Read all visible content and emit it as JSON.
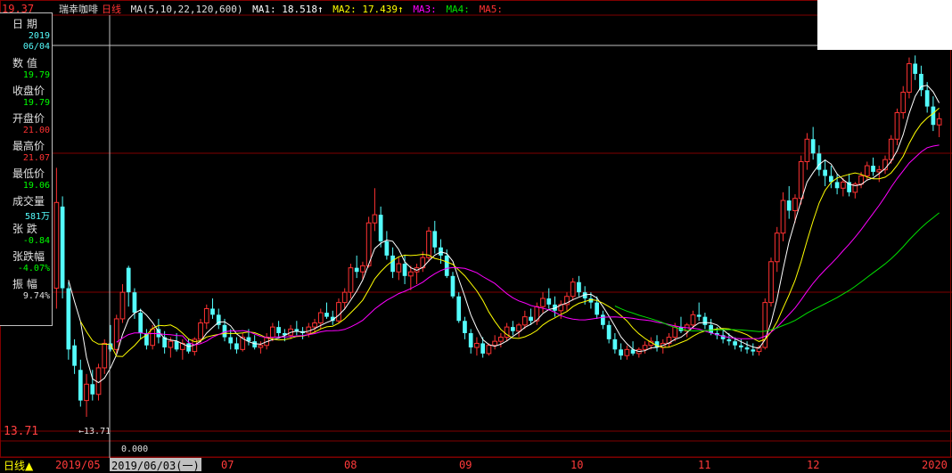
{
  "header": {
    "stock_name": "瑞幸咖啡",
    "period_label": "日线",
    "ma_label": "MA(5,10,22,120,600)",
    "ma1": "MA1: 18.518↑",
    "ma2": "MA2: 17.439↑",
    "ma3": "MA3:",
    "ma4": "MA4:",
    "ma5": "MA5:",
    "top_left_price": "19.37"
  },
  "colors": {
    "up": "#ff3232",
    "down": "#54fcfc",
    "ma1": "#ffffff",
    "ma2": "#ffff00",
    "ma3": "#ff00ff",
    "ma4": "#00e000",
    "grid": "#800000",
    "crosshair": "#c0c0c0"
  },
  "info_panel": {
    "items": [
      {
        "label": "日 期",
        "value": "2019",
        "value2": "06/04",
        "color": "#54fcfc"
      },
      {
        "label": "数 值",
        "value": "19.79",
        "color": "#00ff00"
      },
      {
        "label": "收盘价",
        "value": "19.79",
        "color": "#00ff00"
      },
      {
        "label": "开盘价",
        "value": "21.00",
        "color": "#ff3232"
      },
      {
        "label": "最高价",
        "value": "21.07",
        "color": "#ff3232"
      },
      {
        "label": "最低价",
        "value": "19.06",
        "color": "#00ff00"
      },
      {
        "label": "成交量",
        "value": "581万",
        "color": "#54fcfc"
      },
      {
        "label": "张 跌",
        "value": "-0.84",
        "color": "#00ff00"
      },
      {
        "label": "张跌幅",
        "value": "-4.07%",
        "color": "#00ff00"
      },
      {
        "label": "振 幅",
        "value": "9.74%",
        "color": "#e0e0e0"
      }
    ]
  },
  "annotations": {
    "low_marker": "←13.71",
    "left_axis_price": "13.71",
    "zero_value": "0.000"
  },
  "time_axis": {
    "period_button": "日线▲",
    "selected_date": "2019/06/03(一)",
    "labels": [
      "2019/05",
      "07",
      "08",
      "09",
      "10",
      "11",
      "12",
      "2020"
    ]
  },
  "chart_data": {
    "type": "candlestick",
    "title": "",
    "y_range": [
      13.0,
      31.5
    ],
    "low_price": 13.71,
    "candles_note": "daily OHLC approx, 2019/05 - 2020/01",
    "ohlc": [
      [
        20.0,
        25.9,
        19.0,
        24.2
      ],
      [
        24.0,
        24.5,
        19.5,
        20.0
      ],
      [
        20.0,
        20.3,
        16.5,
        17.0
      ],
      [
        17.2,
        17.5,
        15.8,
        16.2
      ],
      [
        16.0,
        16.5,
        14.2,
        14.5
      ],
      [
        14.5,
        15.8,
        13.7,
        15.3
      ],
      [
        15.3,
        16.0,
        14.5,
        14.8
      ],
      [
        14.8,
        16.3,
        14.5,
        16.1
      ],
      [
        16.1,
        17.5,
        15.8,
        17.3
      ],
      [
        17.3,
        18.2,
        16.9,
        17.0
      ],
      [
        17.0,
        18.7,
        16.8,
        18.5
      ],
      [
        18.5,
        20.2,
        18.3,
        19.8
      ],
      [
        21.0,
        21.1,
        19.1,
        19.8
      ],
      [
        19.8,
        20.0,
        18.5,
        18.8
      ],
      [
        18.8,
        19.0,
        17.5,
        17.8
      ],
      [
        17.8,
        18.0,
        17.0,
        17.2
      ],
      [
        17.2,
        18.2,
        17.0,
        18.0
      ],
      [
        18.0,
        18.5,
        17.3,
        17.6
      ],
      [
        17.6,
        17.9,
        16.8,
        17.1
      ],
      [
        17.1,
        17.6,
        16.6,
        17.4
      ],
      [
        17.4,
        17.8,
        16.9,
        17.0
      ],
      [
        17.0,
        17.5,
        16.5,
        17.3
      ],
      [
        17.3,
        17.5,
        16.8,
        16.9
      ],
      [
        16.9,
        17.6,
        16.7,
        17.5
      ],
      [
        17.5,
        18.5,
        17.3,
        18.3
      ],
      [
        18.3,
        19.2,
        18.0,
        19.0
      ],
      [
        19.0,
        19.5,
        18.5,
        18.7
      ],
      [
        18.7,
        19.0,
        18.0,
        18.2
      ],
      [
        18.2,
        18.5,
        17.4,
        17.6
      ],
      [
        17.6,
        18.0,
        17.0,
        17.3
      ],
      [
        17.3,
        17.6,
        16.8,
        17.0
      ],
      [
        17.0,
        17.8,
        16.9,
        17.6
      ],
      [
        17.6,
        18.0,
        17.2,
        17.4
      ],
      [
        17.4,
        17.7,
        17.0,
        17.1
      ],
      [
        17.1,
        17.4,
        16.8,
        17.2
      ],
      [
        17.2,
        17.8,
        17.0,
        17.6
      ],
      [
        17.6,
        18.3,
        17.4,
        18.1
      ],
      [
        18.1,
        18.4,
        17.6,
        17.8
      ],
      [
        17.8,
        18.0,
        17.4,
        17.7
      ],
      [
        17.7,
        18.2,
        17.5,
        18.0
      ],
      [
        18.0,
        18.4,
        17.7,
        17.9
      ],
      [
        17.9,
        18.1,
        17.5,
        17.8
      ],
      [
        17.8,
        18.3,
        17.6,
        18.1
      ],
      [
        18.1,
        18.5,
        17.8,
        18.3
      ],
      [
        18.3,
        19.0,
        18.0,
        18.8
      ],
      [
        18.8,
        19.3,
        18.5,
        18.6
      ],
      [
        18.6,
        18.9,
        18.2,
        18.4
      ],
      [
        18.4,
        19.5,
        18.3,
        19.3
      ],
      [
        19.3,
        20.0,
        19.0,
        19.8
      ],
      [
        19.8,
        21.2,
        19.5,
        21.0
      ],
      [
        21.0,
        21.6,
        20.5,
        20.8
      ],
      [
        20.8,
        21.3,
        20.4,
        21.1
      ],
      [
        21.1,
        23.5,
        21.0,
        23.2
      ],
      [
        23.2,
        24.9,
        22.8,
        23.6
      ],
      [
        23.6,
        24.0,
        22.0,
        22.3
      ],
      [
        22.3,
        22.8,
        21.4,
        21.6
      ],
      [
        21.6,
        22.0,
        20.5,
        20.8
      ],
      [
        20.8,
        21.5,
        20.4,
        21.2
      ],
      [
        21.2,
        21.6,
        20.2,
        20.6
      ],
      [
        20.6,
        21.1,
        19.9,
        20.8
      ],
      [
        20.8,
        21.2,
        20.2,
        21.0
      ],
      [
        21.0,
        21.8,
        20.8,
        21.5
      ],
      [
        21.5,
        23.0,
        21.3,
        22.8
      ],
      [
        22.8,
        23.3,
        21.7,
        22.0
      ],
      [
        22.0,
        22.4,
        21.2,
        21.6
      ],
      [
        21.6,
        21.9,
        20.5,
        20.6
      ],
      [
        20.6,
        20.8,
        19.5,
        19.6
      ],
      [
        19.6,
        19.8,
        18.3,
        18.4
      ],
      [
        18.4,
        18.6,
        17.5,
        17.8
      ],
      [
        17.8,
        18.0,
        16.8,
        17.1
      ],
      [
        17.1,
        17.6,
        16.7,
        17.3
      ],
      [
        17.3,
        17.6,
        16.6,
        16.8
      ],
      [
        16.8,
        17.3,
        16.7,
        17.2
      ],
      [
        17.2,
        17.7,
        17.0,
        17.4
      ],
      [
        17.4,
        17.8,
        17.1,
        17.6
      ],
      [
        17.6,
        18.3,
        17.4,
        18.1
      ],
      [
        18.1,
        18.4,
        17.7,
        17.9
      ],
      [
        17.9,
        18.3,
        17.6,
        18.2
      ],
      [
        18.2,
        18.9,
        18.0,
        18.6
      ],
      [
        18.6,
        19.0,
        18.2,
        18.4
      ],
      [
        18.4,
        19.3,
        18.2,
        19.1
      ],
      [
        19.1,
        19.8,
        18.8,
        19.5
      ],
      [
        19.5,
        20.0,
        19.0,
        19.2
      ],
      [
        19.2,
        19.6,
        18.6,
        18.9
      ],
      [
        18.9,
        19.4,
        18.5,
        19.2
      ],
      [
        19.2,
        19.8,
        18.9,
        19.6
      ],
      [
        19.6,
        20.5,
        19.4,
        20.3
      ],
      [
        20.3,
        20.6,
        19.6,
        19.8
      ],
      [
        19.8,
        20.1,
        19.2,
        19.5
      ],
      [
        19.5,
        19.8,
        19.0,
        19.3
      ],
      [
        19.3,
        19.6,
        18.5,
        18.7
      ],
      [
        18.7,
        18.9,
        18.0,
        18.2
      ],
      [
        18.2,
        18.4,
        17.3,
        17.5
      ],
      [
        17.5,
        17.8,
        16.8,
        17.0
      ],
      [
        17.0,
        17.3,
        16.5,
        16.7
      ],
      [
        16.7,
        17.2,
        16.5,
        17.0
      ],
      [
        17.0,
        17.4,
        16.7,
        16.8
      ],
      [
        16.8,
        17.1,
        16.6,
        17.0
      ],
      [
        17.0,
        17.4,
        16.8,
        17.2
      ],
      [
        17.2,
        17.6,
        17.0,
        17.4
      ],
      [
        17.4,
        17.7,
        16.9,
        17.1
      ],
      [
        17.1,
        17.5,
        16.8,
        17.3
      ],
      [
        17.3,
        17.8,
        17.1,
        17.6
      ],
      [
        17.6,
        18.3,
        17.4,
        18.1
      ],
      [
        18.1,
        18.6,
        17.8,
        17.9
      ],
      [
        17.9,
        18.3,
        17.6,
        18.2
      ],
      [
        18.2,
        18.9,
        18.0,
        18.7
      ],
      [
        18.7,
        19.3,
        18.4,
        18.6
      ],
      [
        18.6,
        18.8,
        18.0,
        18.2
      ],
      [
        18.2,
        18.5,
        17.7,
        17.8
      ],
      [
        17.8,
        18.1,
        17.5,
        17.7
      ],
      [
        17.7,
        18.0,
        17.3,
        17.5
      ],
      [
        17.5,
        17.8,
        17.2,
        17.4
      ],
      [
        17.4,
        17.6,
        17.0,
        17.2
      ],
      [
        17.2,
        17.5,
        16.9,
        17.1
      ],
      [
        17.1,
        17.4,
        16.8,
        17.0
      ],
      [
        17.0,
        17.3,
        16.7,
        16.9
      ],
      [
        16.9,
        17.2,
        16.7,
        17.1
      ],
      [
        17.1,
        19.5,
        17.0,
        19.3
      ],
      [
        19.3,
        21.5,
        19.1,
        21.3
      ],
      [
        21.3,
        23.0,
        20.8,
        22.7
      ],
      [
        22.7,
        24.7,
        22.3,
        24.3
      ],
      [
        24.3,
        25.0,
        23.4,
        23.8
      ],
      [
        23.8,
        24.6,
        23.2,
        24.4
      ],
      [
        24.4,
        26.5,
        24.1,
        26.2
      ],
      [
        26.2,
        27.6,
        25.8,
        27.3
      ],
      [
        27.3,
        27.9,
        26.3,
        26.6
      ],
      [
        26.6,
        27.0,
        25.5,
        25.8
      ],
      [
        25.8,
        26.3,
        25.0,
        25.5
      ],
      [
        25.5,
        26.0,
        24.9,
        25.2
      ],
      [
        25.2,
        25.6,
        24.6,
        24.9
      ],
      [
        24.9,
        25.4,
        24.5,
        25.2
      ],
      [
        25.2,
        25.6,
        24.5,
        24.7
      ],
      [
        24.7,
        25.2,
        24.4,
        25.1
      ],
      [
        25.1,
        25.7,
        24.9,
        25.5
      ],
      [
        25.5,
        26.2,
        25.3,
        26.0
      ],
      [
        26.0,
        26.4,
        25.5,
        25.7
      ],
      [
        25.7,
        26.0,
        25.2,
        25.8
      ],
      [
        25.8,
        26.5,
        25.6,
        26.3
      ],
      [
        26.3,
        27.5,
        26.1,
        27.3
      ],
      [
        27.3,
        28.8,
        27.0,
        28.6
      ],
      [
        28.6,
        29.9,
        28.3,
        29.6
      ],
      [
        29.6,
        31.3,
        29.3,
        31.0
      ],
      [
        31.0,
        31.4,
        30.2,
        30.5
      ],
      [
        30.5,
        30.9,
        29.4,
        29.7
      ],
      [
        29.7,
        30.1,
        28.6,
        28.9
      ],
      [
        28.9,
        29.4,
        27.7,
        28.0
      ],
      [
        28.0,
        28.6,
        27.4,
        28.3
      ]
    ]
  }
}
